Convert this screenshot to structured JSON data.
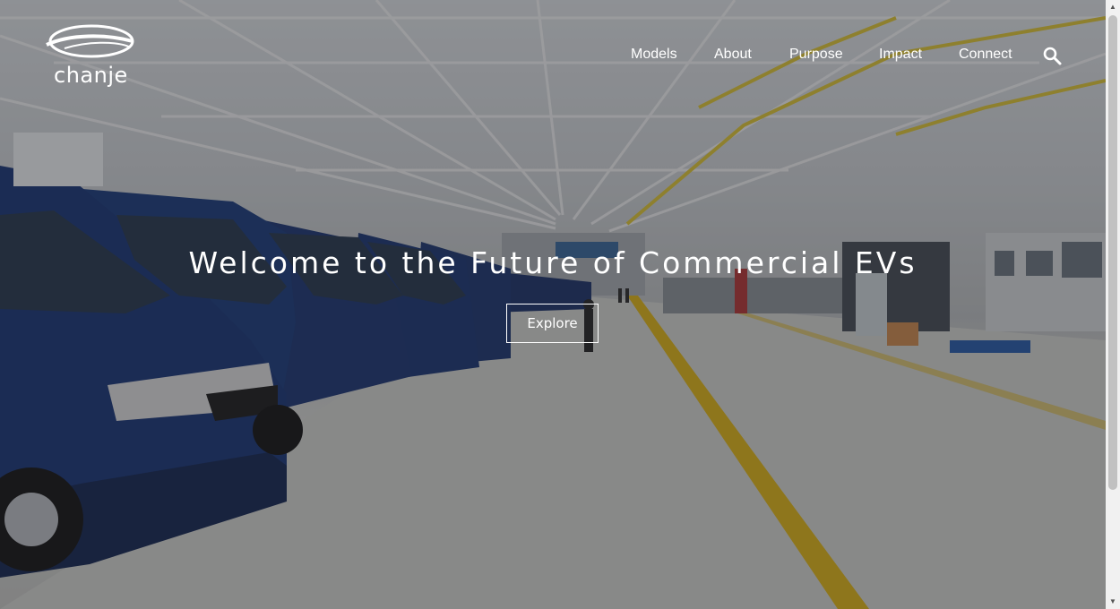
{
  "brand": {
    "logo_text": "chanje"
  },
  "nav": {
    "items": [
      {
        "label": "Models"
      },
      {
        "label": "About"
      },
      {
        "label": "Purpose"
      },
      {
        "label": "Impact"
      },
      {
        "label": "Connect"
      }
    ],
    "search_icon": "search-icon"
  },
  "hero": {
    "headline": "Welcome to the Future of Commercial EVs",
    "cta_label": "Explore",
    "background": "factory-floor-with-blue-electric-vans",
    "accent_colors": {
      "van_blue": "#1f3a78",
      "floor_line": "#d8b21e",
      "overlay": "#14161a"
    }
  }
}
